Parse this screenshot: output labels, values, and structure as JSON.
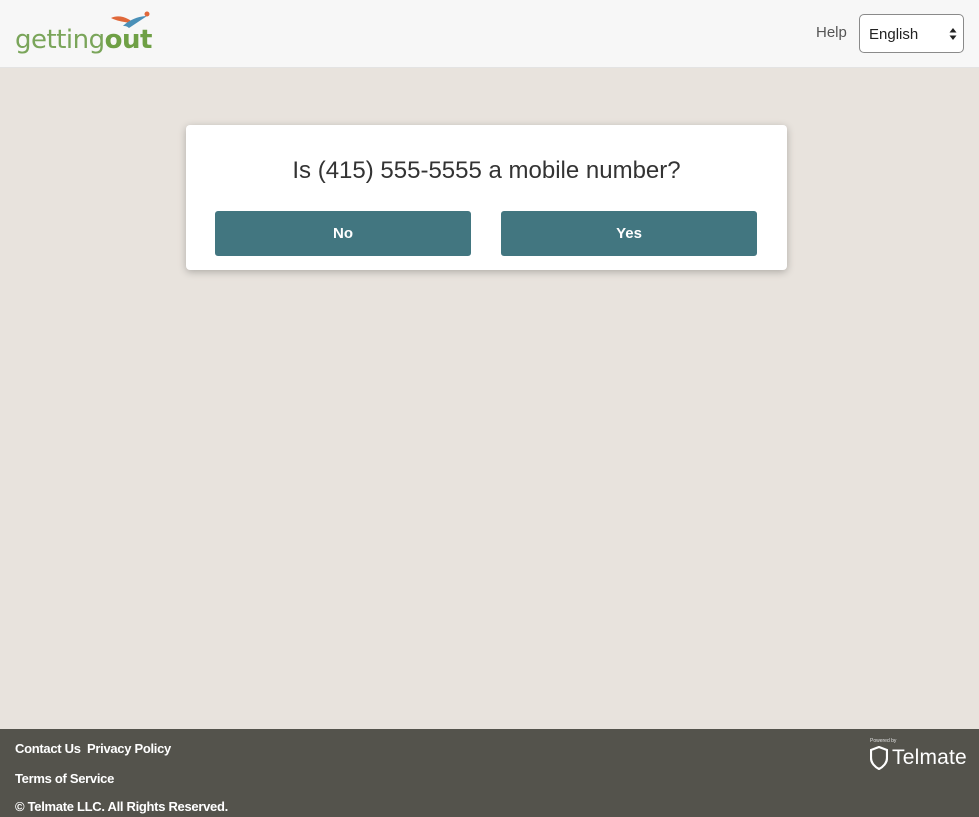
{
  "header": {
    "logo": {
      "part1": "getting",
      "part2": "out"
    },
    "help_label": "Help",
    "language": {
      "selected": "English"
    }
  },
  "dialog": {
    "question": "Is (415) 555-5555 a mobile number?",
    "no_label": "No",
    "yes_label": "Yes"
  },
  "footer": {
    "links": {
      "contact": "Contact Us",
      "privacy": "Privacy Policy",
      "terms": "Terms of Service"
    },
    "copyright": "© Telmate LLC. All Rights Reserved.",
    "brand": {
      "powered_by": "Powered by",
      "name": "Telmate"
    }
  },
  "colors": {
    "page_background": "#e8e3dd",
    "header_background": "#f7f7f7",
    "button": "#427680",
    "footer_background": "#54534c",
    "logo_green": "#6fa045"
  },
  "icons": {
    "logo_mark": "bird-swoosh-icon",
    "select_arrows": "updown-arrows-icon",
    "telmate_shield": "shield-icon"
  }
}
